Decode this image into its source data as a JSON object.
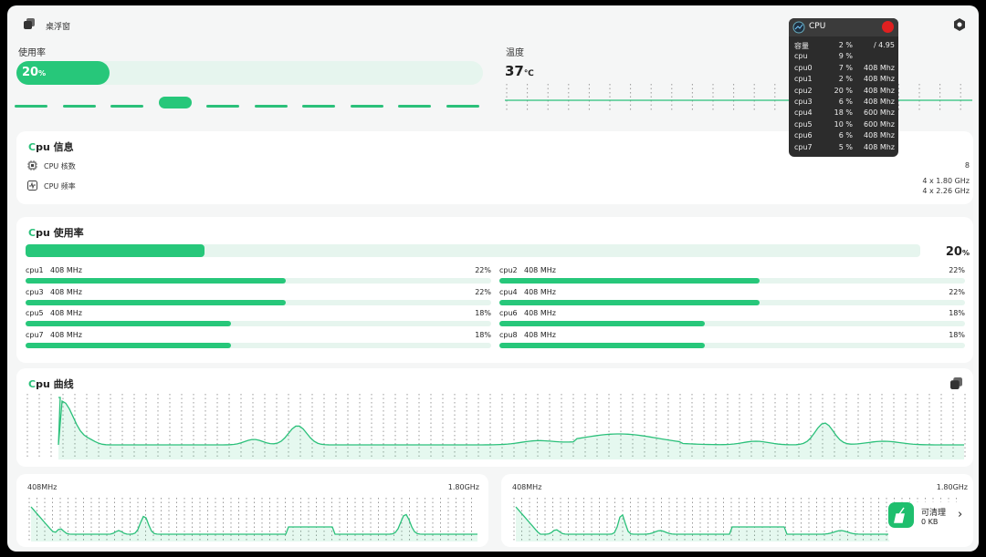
{
  "header": {
    "float_label": "桌浮窗"
  },
  "usage": {
    "label": "使用率",
    "value": "20",
    "unit": "%",
    "fraction": 0.2
  },
  "temperature": {
    "label": "温度",
    "value": "37",
    "unit": "℃"
  },
  "page_indicator": {
    "count": 10,
    "active_index": 3
  },
  "cpu_info": {
    "title_c": "C",
    "title_rest": "pu 信息",
    "cores_label": "CPU 核数",
    "cores_value": "8",
    "freq_label": "CPU 频率",
    "freq_value_1": "4 x 1.80 GHz",
    "freq_value_2": "4 x 2.26 GHz"
  },
  "cpu_usage": {
    "title_c": "C",
    "title_rest": "pu 使用率",
    "total_value": "20",
    "total_unit": "%",
    "total_fraction": 0.2,
    "cores": [
      {
        "name": "cpu1",
        "freq": "408 MHz",
        "pct": "22%",
        "fraction": 0.22
      },
      {
        "name": "cpu2",
        "freq": "408 MHz",
        "pct": "22%",
        "fraction": 0.22
      },
      {
        "name": "cpu3",
        "freq": "408 MHz",
        "pct": "22%",
        "fraction": 0.22
      },
      {
        "name": "cpu4",
        "freq": "408 MHz",
        "pct": "22%",
        "fraction": 0.22
      },
      {
        "name": "cpu5",
        "freq": "408 MHz",
        "pct": "18%",
        "fraction": 0.18
      },
      {
        "name": "cpu6",
        "freq": "408 MHz",
        "pct": "18%",
        "fraction": 0.18
      },
      {
        "name": "cpu7",
        "freq": "408 MHz",
        "pct": "18%",
        "fraction": 0.18
      },
      {
        "name": "cpu8",
        "freq": "408 MHz",
        "pct": "18%",
        "fraction": 0.18
      }
    ]
  },
  "cpu_curve": {
    "title_c": "C",
    "title_rest": "pu 曲线"
  },
  "freq_cards": [
    {
      "min_label": "408MHz",
      "max_label": "1.80GHz"
    },
    {
      "min_label": "408MHz",
      "max_label": "1.80GHz"
    }
  ],
  "popup": {
    "title": "CPU",
    "rows": [
      {
        "name": "容量",
        "pct": "2 %",
        "freq": "/ 4.95"
      },
      {
        "name": "cpu",
        "pct": "9 %",
        "freq": ""
      },
      {
        "name": "cpu0",
        "pct": "7 %",
        "freq": "408 Mhz"
      },
      {
        "name": "cpu1",
        "pct": "2 %",
        "freq": "408 Mhz"
      },
      {
        "name": "cpu2",
        "pct": "20 %",
        "freq": "408 Mhz"
      },
      {
        "name": "cpu3",
        "pct": "6 %",
        "freq": "408 Mhz"
      },
      {
        "name": "cpu4",
        "pct": "18 %",
        "freq": "600 Mhz"
      },
      {
        "name": "cpu5",
        "pct": "10 %",
        "freq": "600 Mhz"
      },
      {
        "name": "cpu6",
        "pct": "6 %",
        "freq": "408 Mhz"
      },
      {
        "name": "cpu7",
        "pct": "5 %",
        "freq": "408 Mhz"
      }
    ]
  },
  "clean_widget": {
    "label": "可清理",
    "size": "0 KB"
  },
  "colors": {
    "accent": "#27c77a",
    "track": "#e6f5ee",
    "popup_bg": "#2c2c2c",
    "close": "#e02020"
  }
}
